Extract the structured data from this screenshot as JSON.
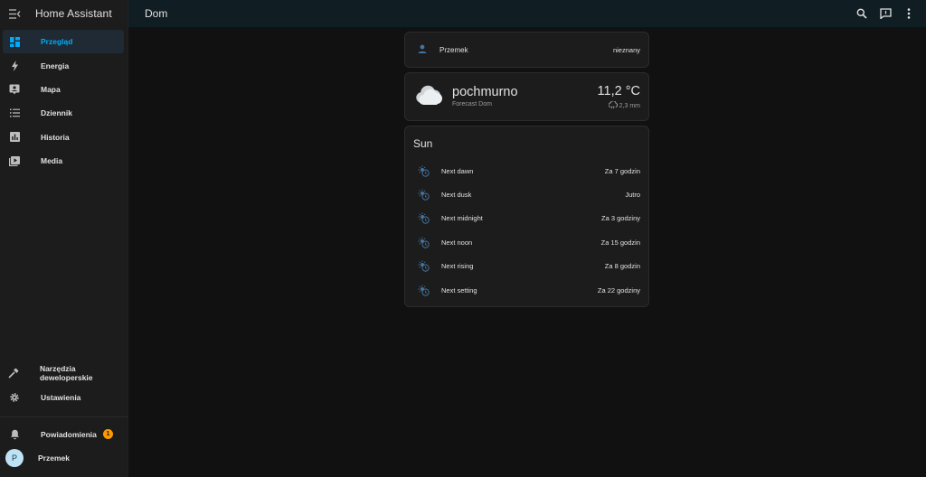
{
  "app": {
    "title": "Home Assistant"
  },
  "sidebar": {
    "items": [
      {
        "label": "Przegląd",
        "icon": "dashboard-icon",
        "active": true
      },
      {
        "label": "Energia",
        "icon": "lightning-bolt-icon"
      },
      {
        "label": "Mapa",
        "icon": "map-account-icon"
      },
      {
        "label": "Dziennik",
        "icon": "logbook-list-icon"
      },
      {
        "label": "Historia",
        "icon": "chart-box-icon"
      },
      {
        "label": "Media",
        "icon": "media-play-icon"
      }
    ],
    "bottom": {
      "developer_tools": "Narzędzia deweloperskie",
      "settings": "Ustawienia",
      "notifications": "Powiadomienia",
      "notifications_badge": "1",
      "user_name": "Przemek",
      "user_initial": "P"
    }
  },
  "topbar": {
    "title": "Dom"
  },
  "person_card": {
    "name": "Przemek",
    "state": "nieznany"
  },
  "weather_card": {
    "condition": "pochmurno",
    "subtitle": "Forecast Dom",
    "temperature": "11,2 °C",
    "precipitation": "2,3 mm",
    "icon": "cloudy-icon"
  },
  "sun_card": {
    "title": "Sun",
    "rows": [
      {
        "label": "Next dawn",
        "value": "Za 7 godzin"
      },
      {
        "label": "Next dusk",
        "value": "Jutro"
      },
      {
        "label": "Next midnight",
        "value": "Za 3 godziny"
      },
      {
        "label": "Next noon",
        "value": "Za 15 godzin"
      },
      {
        "label": "Next rising",
        "value": "Za 8 godzin"
      },
      {
        "label": "Next setting",
        "value": "Za 22 godziny"
      }
    ]
  },
  "colors": {
    "accent": "#03a9f4",
    "icon_blue": "#44739e",
    "badge": "#ff9800",
    "sidebar_bg": "#1c1c1c",
    "topbar_bg": "#101e24",
    "page_bg": "#111111"
  }
}
